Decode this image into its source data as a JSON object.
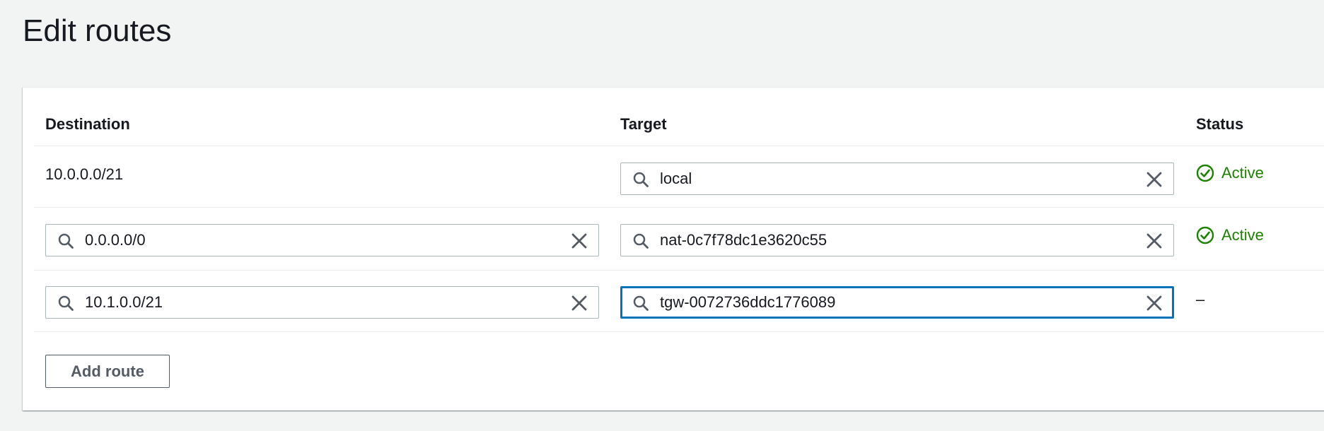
{
  "page": {
    "title": "Edit routes"
  },
  "columns": {
    "destination": "Destination",
    "target": "Target",
    "status": "Status"
  },
  "routes": [
    {
      "destination": "10.0.0.0/21",
      "destination_editable": false,
      "target": "local",
      "status": "Active"
    },
    {
      "destination": "0.0.0.0/0",
      "destination_editable": true,
      "target": "nat-0c7f78dc1e3620c55",
      "status": "Active"
    },
    {
      "destination": "10.1.0.0/21",
      "destination_editable": true,
      "target": "tgw-0072736ddc1776089",
      "target_focused": true,
      "status": "–"
    }
  ],
  "actions": {
    "add_route_label": "Add route"
  },
  "icons": {
    "search": "search-icon",
    "clear": "close-icon",
    "status_active": "check-circle-icon"
  },
  "colors": {
    "active_status": "#1d8102",
    "focus_border": "#0073bb",
    "page_background": "#f2f3f3"
  }
}
